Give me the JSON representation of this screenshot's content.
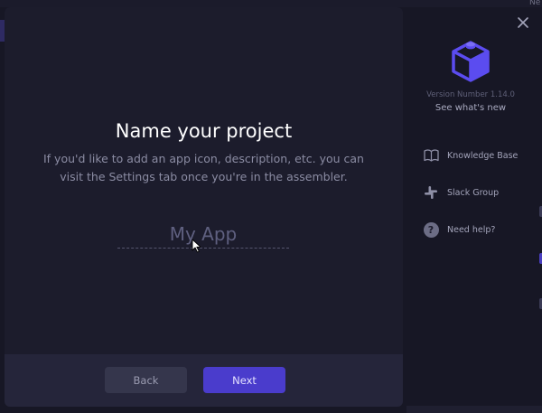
{
  "background": {
    "corner_text": "Ne"
  },
  "dialog": {
    "title": "Name your project",
    "description": "If you'd like to add an app icon, description, etc. you can visit the Settings tab once you're in the assembler.",
    "project_name": {
      "value": "",
      "placeholder": "My App"
    },
    "buttons": {
      "back_label": "Back",
      "next_label": "Next"
    }
  },
  "side_panel": {
    "logo_icon": "cube-icon",
    "version_text": "Version Number 1.14.0",
    "whats_new_label": "See what's new",
    "resources": [
      {
        "icon": "book-icon",
        "label": "Knowledge Base"
      },
      {
        "icon": "slack-icon",
        "label": "Slack Group"
      },
      {
        "icon": "help-icon",
        "label": "Need help?"
      }
    ]
  },
  "colors": {
    "background": "#171725",
    "dialog": "#1c1c2c",
    "footer": "#25253a",
    "accent": "#4a3ccc",
    "logo": "#5b4cf0"
  }
}
